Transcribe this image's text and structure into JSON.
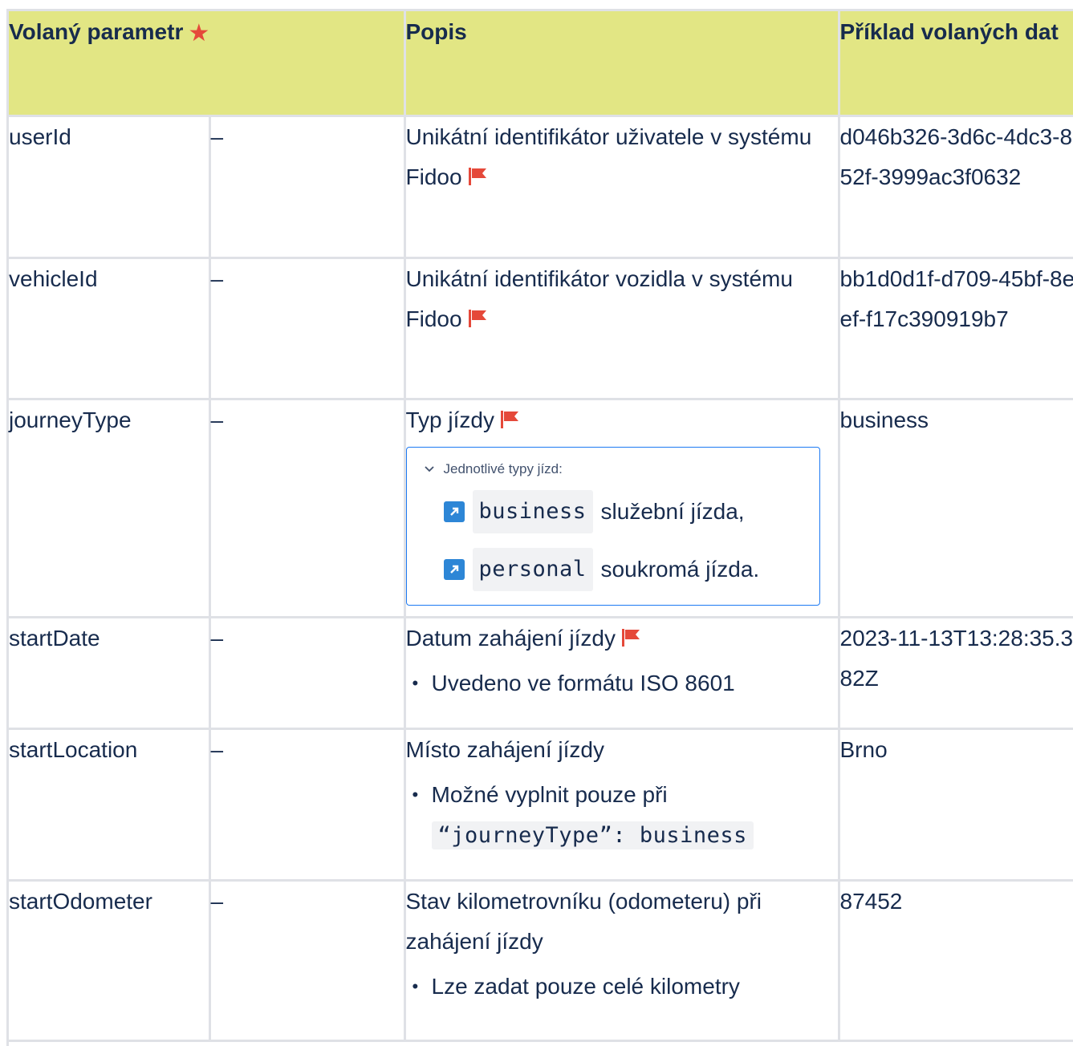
{
  "header": {
    "col_param": "Volaný parametr",
    "col_desc": "Popis",
    "col_example": "Příklad volaných dat"
  },
  "rows": [
    {
      "param": "userId",
      "dash": "–",
      "desc": "Unikátní identifikátor uživatele v systému Fidoo",
      "example": "d046b326-3d6c-4dc3-852f-3999ac3f0632"
    },
    {
      "param": "vehicleId",
      "dash": "–",
      "desc": "Unikátní identifikátor vozidla v systému Fidoo",
      "example": "bb1d0d1f-d709-45bf-8eef-f17c390919b7"
    },
    {
      "param": "journeyType",
      "dash": "–",
      "desc": "Typ jízdy",
      "example": "business",
      "expand": {
        "title": "Jednotlivé typy jízd:",
        "items": [
          {
            "code": "business",
            "text": "služební jízda,"
          },
          {
            "code": "personal",
            "text": "soukromá jízda."
          }
        ]
      }
    },
    {
      "param": "startDate",
      "dash": "–",
      "desc": "Datum zahájení jízdy",
      "bullet": "Uvedeno ve formátu ISO 8601",
      "example": "2023-11-13T13:28:35.382Z"
    },
    {
      "param": "startLocation",
      "dash": "–",
      "desc": "Místo zahájení jízdy",
      "bullet": "Možné vyplnit pouze při",
      "bullet_code": "“journeyType”: business",
      "example": "Brno"
    },
    {
      "param": "startOdometer",
      "dash": "–",
      "desc": "Stav kilometrovníku (odometeru) při zahájení jízdy",
      "bullet": "Lze zadat pouze celé kilometry",
      "example": "87452"
    }
  ],
  "colors": {
    "header_bg": "#e2e684",
    "border": "#dfe1e6",
    "flag": "#e5493a",
    "expand_border": "#1d7af3",
    "arrow_box": "#2d86d6"
  }
}
